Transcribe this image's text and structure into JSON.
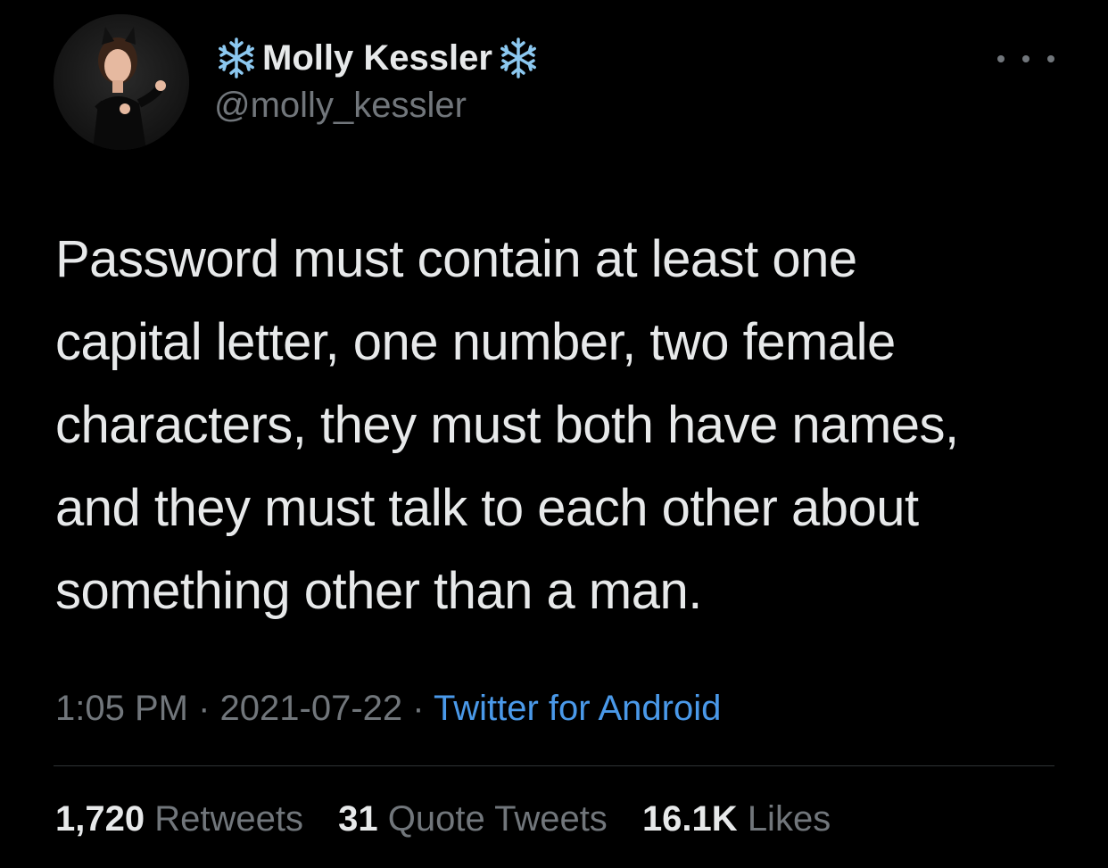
{
  "author": {
    "display_name": "Molly Kessler",
    "name_decoration_icon": "snowflake-icon",
    "handle": "@molly_kessler"
  },
  "tweet": {
    "text_lines": [
      "Password must contain at least one",
      "capital letter, one number, two female",
      "characters, they must both have names,",
      "and they must talk to each other about",
      "something other than a man."
    ]
  },
  "meta": {
    "time": "1:05 PM",
    "separator": "·",
    "date": "2021-07-22",
    "source": "Twitter for Android"
  },
  "stats": {
    "retweets_count": "1,720",
    "retweets_label": "Retweets",
    "quotes_count": "31",
    "quotes_label": "Quote Tweets",
    "likes_count": "16.1K",
    "likes_label": "Likes"
  },
  "colors": {
    "background": "#000000",
    "primary_text": "#e7e9ea",
    "secondary_text": "#71767b",
    "link": "#4a99e9",
    "snowflake": "#8cc8f0",
    "divider": "#2f3336"
  }
}
